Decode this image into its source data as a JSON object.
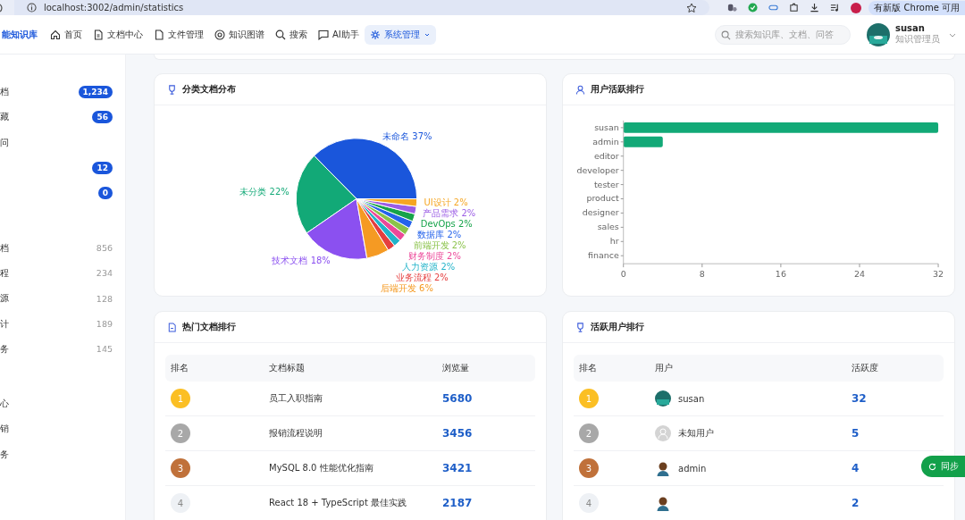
{
  "browser": {
    "url": "localhost:3002/admin/statistics",
    "update_button": "有新版 Chrome 可用"
  },
  "header": {
    "brand": "能知识库",
    "nav": [
      {
        "label": "首页",
        "selected": false
      },
      {
        "label": "文档中心",
        "selected": false
      },
      {
        "label": "文件管理",
        "selected": false
      },
      {
        "label": "知识图谱",
        "selected": false
      },
      {
        "label": "搜索",
        "selected": false
      },
      {
        "label": "AI助手",
        "selected": false
      },
      {
        "label": "系统管理",
        "selected": true
      }
    ],
    "search": {
      "placeholder": "搜索知识库、文档、问答"
    },
    "user": {
      "name": "susan",
      "role": "知识管理员"
    }
  },
  "sidebar": {
    "groups": [
      {
        "items": [
          {
            "label": "档",
            "kind": "badge",
            "count": "1,234"
          },
          {
            "label": "藏",
            "kind": "badge",
            "count": "56"
          },
          {
            "label": "问",
            "kind": "plain"
          },
          {
            "kind": "badge",
            "count": "12"
          },
          {
            "kind": "badge",
            "count": "0"
          }
        ]
      },
      {
        "items": [
          {
            "label": "档",
            "kind": "count",
            "count": "856"
          },
          {
            "label": "程",
            "kind": "count",
            "count": "234"
          },
          {
            "label": "源",
            "kind": "count",
            "count": "128"
          },
          {
            "label": "计",
            "kind": "count",
            "count": "189"
          },
          {
            "label": "务",
            "kind": "count",
            "count": "145"
          }
        ]
      },
      {
        "items": [
          {
            "label": "心",
            "kind": "plain"
          },
          {
            "label": "销",
            "kind": "plain"
          },
          {
            "label": "务",
            "kind": "plain"
          }
        ]
      }
    ]
  },
  "pie_card": {
    "title": "分类文档分布",
    "chart_data": {
      "type": "pie",
      "categories": [
        "未命名",
        "未分类",
        "技术文档",
        "后端开发",
        "业务流程",
        "人力资源",
        "财务制度",
        "前端开发",
        "数据库",
        "DevOps",
        "产品需求",
        "UI设计"
      ],
      "values": [
        37,
        22,
        18,
        6,
        2,
        2,
        2,
        2,
        2,
        2,
        2,
        2
      ],
      "value_labels": [
        "37%",
        "22%",
        "18%",
        "6%",
        "2%",
        "2%",
        "2%",
        "2%",
        "2%",
        "2%",
        "2%",
        "2%"
      ]
    }
  },
  "bar_card": {
    "title": "用户活跃排行",
    "chart_data": {
      "type": "bar",
      "orientation": "horizontal",
      "categories": [
        "susan",
        "admin",
        "editor",
        "developer",
        "tester",
        "product",
        "designer",
        "sales",
        "hr",
        "finance"
      ],
      "values": [
        32,
        4,
        0,
        0,
        0,
        0,
        0,
        0,
        0,
        0
      ],
      "xlim": [
        0,
        32
      ],
      "xticks": [
        0,
        8,
        16,
        24,
        32
      ]
    }
  },
  "docs_card": {
    "title": "热门文档排行",
    "columns": [
      "排名",
      "文档标题",
      "浏览量"
    ],
    "rows": [
      {
        "rank": "1",
        "title": "员工入职指南",
        "views": "5680"
      },
      {
        "rank": "2",
        "title": "报销流程说明",
        "views": "3456"
      },
      {
        "rank": "3",
        "title": "MySQL 8.0 性能优化指南",
        "views": "3421"
      },
      {
        "rank": "4",
        "title": "React 18 + TypeScript 最佳实践",
        "views": "2187"
      }
    ]
  },
  "users_card": {
    "title": "活跃用户排行",
    "columns": [
      "排名",
      "用户",
      "活跃度"
    ],
    "rows": [
      {
        "rank": "1",
        "user": "susan",
        "kind": "photo",
        "score": "32"
      },
      {
        "rank": "2",
        "user": "未知用户",
        "kind": "default",
        "score": "5"
      },
      {
        "rank": "3",
        "user": "admin",
        "kind": "person",
        "score": "4"
      },
      {
        "rank": "4",
        "kind": "person",
        "score": "2"
      }
    ]
  },
  "sync_button": {
    "label": "同步"
  }
}
